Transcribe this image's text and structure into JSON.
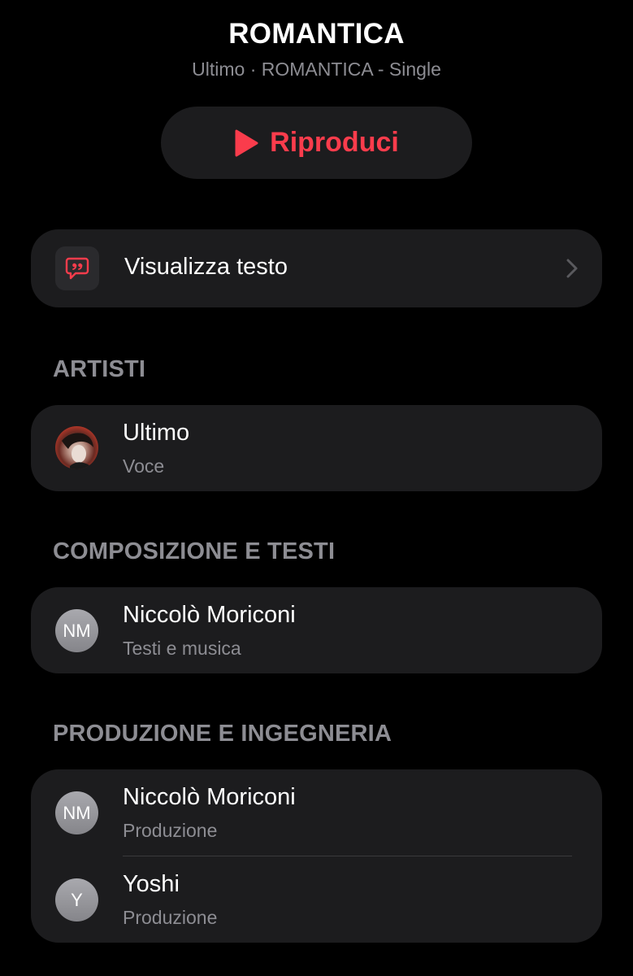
{
  "header": {
    "title": "ROMANTICA",
    "subtitle": "Ultimo · ROMANTICA - Single"
  },
  "play_button": {
    "label": "Riproduci",
    "icon": "play-icon"
  },
  "lyrics": {
    "label": "Visualizza testo",
    "icon": "lyrics-quote-icon",
    "chevron": "chevron-right-icon"
  },
  "sections": {
    "artists": {
      "header": "ARTISTI",
      "items": [
        {
          "name": "Ultimo",
          "role": "Voce",
          "avatar": "photo"
        }
      ]
    },
    "composition": {
      "header": "COMPOSIZIONE E TESTI",
      "items": [
        {
          "name": "Niccolò Moriconi",
          "role": "Testi e musica",
          "initials": "NM"
        }
      ]
    },
    "production": {
      "header": "PRODUZIONE E INGEGNERIA",
      "items": [
        {
          "name": "Niccolò Moriconi",
          "role": "Produzione",
          "initials": "NM"
        },
        {
          "name": "Yoshi",
          "role": "Produzione",
          "initials": "Y"
        }
      ]
    }
  },
  "colors": {
    "background": "#000000",
    "card": "#1c1c1e",
    "accent": "#fa3c4c",
    "secondary_text": "#8d8d93"
  }
}
